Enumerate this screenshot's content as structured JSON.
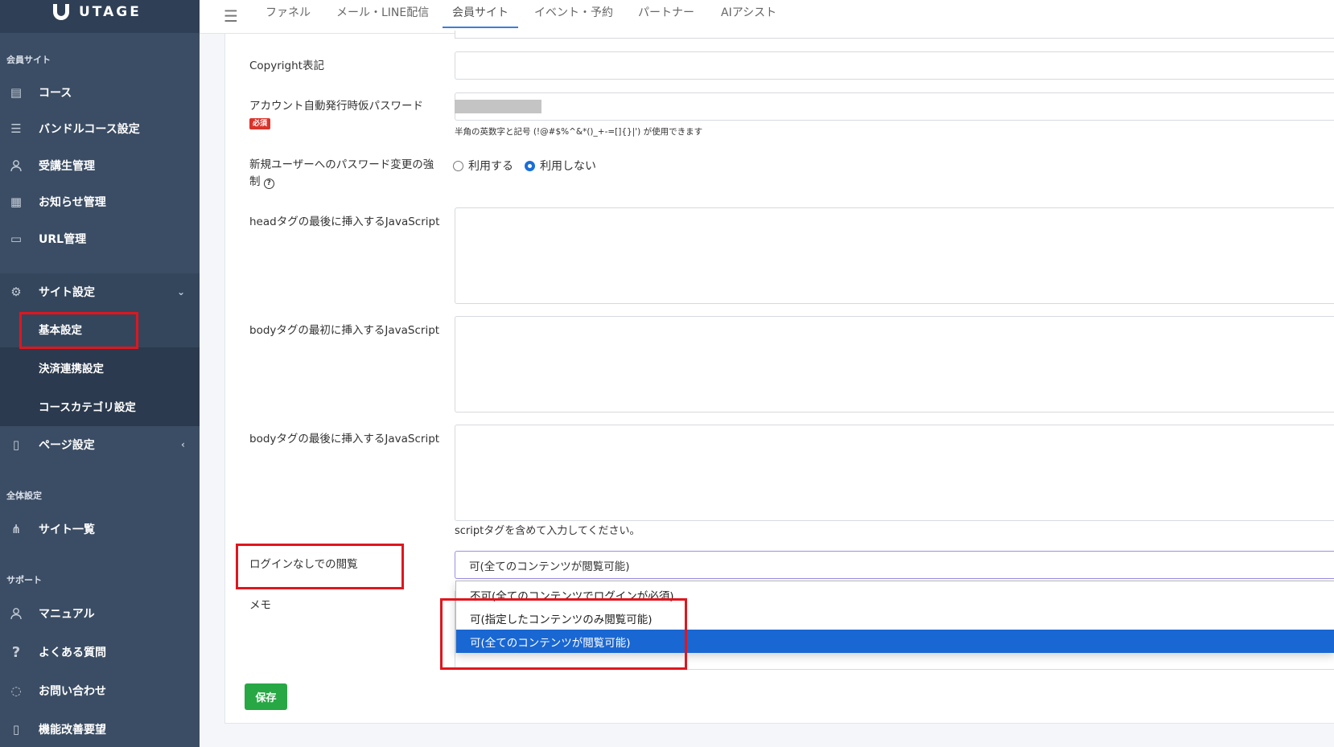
{
  "brand": {
    "name": "UTAGE"
  },
  "sidebar": {
    "section_member_site": "会員サイト",
    "section_global": "全体設定",
    "section_support": "サポート",
    "items": [
      {
        "label": "コース",
        "icon": "list-icon"
      },
      {
        "label": "バンドルコース設定",
        "icon": "bullet-list-icon"
      },
      {
        "label": "受講生管理",
        "icon": "user-icon"
      },
      {
        "label": "お知らせ管理",
        "icon": "newspaper-icon"
      },
      {
        "label": "URL管理",
        "icon": "devices-icon"
      },
      {
        "label": "サイト設定",
        "icon": "gear-icon"
      },
      {
        "label": "ページ設定",
        "icon": "page-icon"
      },
      {
        "label": "サイト一覧",
        "icon": "sitemap-icon"
      },
      {
        "label": "マニュアル",
        "icon": "user-icon"
      },
      {
        "label": "よくある質問",
        "icon": "question-icon"
      },
      {
        "label": "お問い合わせ",
        "icon": "chat-icon"
      },
      {
        "label": "機能改善要望",
        "icon": "document-icon"
      }
    ],
    "sub_items": [
      {
        "label": "基本設定"
      },
      {
        "label": "決済連携設定"
      },
      {
        "label": "コースカテゴリ設定"
      }
    ]
  },
  "topbar": {
    "tabs": [
      "ファネル",
      "メール・LINE配信",
      "会員サイト",
      "イベント・予約",
      "パートナー",
      "AIアシスト"
    ],
    "active_tab": "会員サイト"
  },
  "form": {
    "copyright_label": "Copyright表記",
    "copyright_value": "",
    "temp_password_label": "アカウント自動発行時仮パスワード",
    "required_badge": "必須",
    "temp_password_hint": "半角の英数字と記号 (!@#$%^&*()_+-=[]{}|') が使用できます",
    "force_change_label_1": "新規ユーザーへのパスワード変更の強",
    "force_change_label_2": "制",
    "help_mark": "?",
    "radio_use": "利用する",
    "radio_not_use": "利用しない",
    "radio_selected": "利用しない",
    "head_js_label": "headタグの最後に挿入するJavaScript",
    "body_start_js_label": "bodyタグの最初に挿入するJavaScript",
    "body_end_js_label": "bodyタグの最後に挿入するJavaScript",
    "script_hint": "scriptタグを含めて入力してください。",
    "login_free_label": "ログインなしでの閲覧",
    "login_free_value": "可(全てのコンテンツが閲覧可能)",
    "login_free_options": [
      "不可(全てのコンテンツでログインが必須)",
      "可(指定したコンテンツのみ閲覧可能)",
      "可(全てのコンテンツが閲覧可能)"
    ],
    "memo_label": "メモ",
    "save_label": "保存"
  },
  "colors": {
    "sidebar_bg": "#3b4d64",
    "sidebar_sub_bg": "#2b3a4e",
    "highlight_red": "#e0161e",
    "primary_blue": "#1967d2",
    "save_green": "#28a745"
  }
}
